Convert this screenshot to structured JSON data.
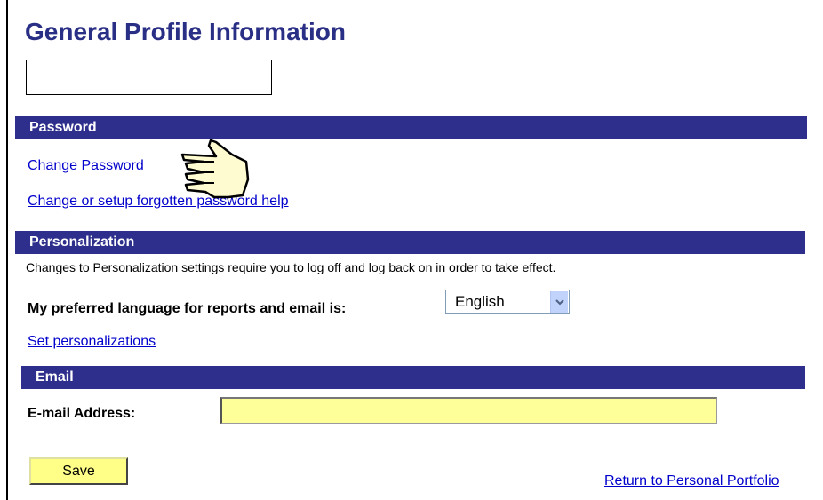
{
  "page": {
    "title": "General Profile Information"
  },
  "password_section": {
    "header": "Password",
    "change_password_link": "Change Password",
    "forgot_password_link": "Change or setup forgotten password help"
  },
  "personalization_section": {
    "header": "Personalization",
    "note": "Changes to Personalization settings require you to log off and log back on in order to take effect.",
    "language_label": "My preferred language for reports and email is:",
    "language_selected": "English",
    "set_personalizations_link": "Set personalizations"
  },
  "email_section": {
    "header": "Email",
    "email_label": "E-mail Address:",
    "email_value": ""
  },
  "actions": {
    "save_label": "Save",
    "return_link": "Return to Personal Portfolio"
  },
  "colors": {
    "title": "#2a2f86",
    "section_bar": "#2e2f8c",
    "link": "#0000cc",
    "email_field": "#ffff99",
    "save_button": "#ffff88"
  },
  "icons": {
    "cursor": "pointing-hand-icon",
    "dropdown": "chevron-down-icon"
  }
}
